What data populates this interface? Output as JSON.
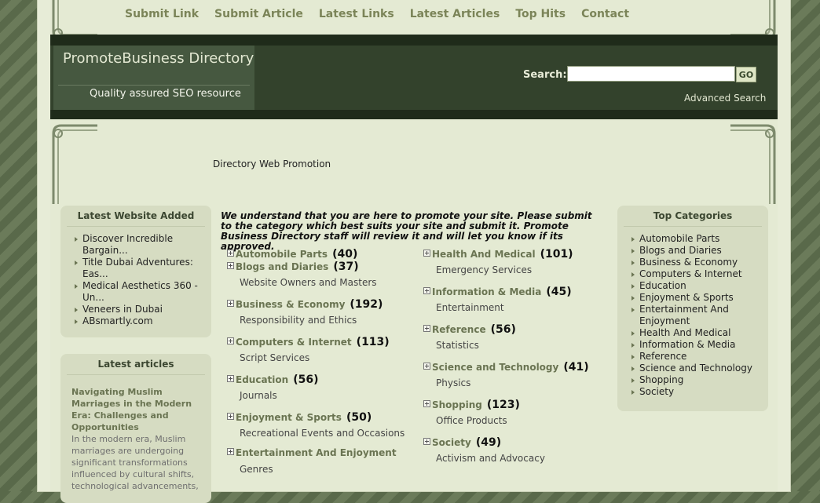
{
  "nav": [
    "Submit Link",
    "Submit Article",
    "Latest Links",
    "Latest Articles",
    "Top Hits",
    "Contact"
  ],
  "header": {
    "title": "PromoteBusiness Directory",
    "subtitle": "Quality assured SEO resource",
    "search_label": "Search:",
    "search_value": "",
    "go_label": "GO",
    "advanced": "Advanced Search"
  },
  "tagline": "Directory Web Promotion",
  "latest_websites": {
    "title": "Latest Website Added",
    "items": [
      "Discover Incredible Bargain...",
      "Title Dubai Adventures: Eas...",
      "Medical Aesthetics 360 - Un...",
      "Veneers in Dubai",
      "ABsmartly.com"
    ]
  },
  "latest_articles": {
    "title": "Latest articles",
    "article_title": "Navigating Muslim Marriages in the Modern Era: Challenges and Opportunities",
    "article_body": "In the modern era, Muslim marriages are undergoing significant transformations influenced by cultural shifts, technological advancements,"
  },
  "intro": "We understand that you are here to promote your site. Please submit to the category which best suits your site and submit it. Promote Business Directory staff will review it and will let you know if its approved.",
  "categories_col1": [
    {
      "name": "Automobile Parts",
      "count": "(40)",
      "sub": ""
    },
    {
      "name": "Blogs and Diaries",
      "count": "(37)",
      "sub": "Website Owners and Masters"
    },
    {
      "name": "Business & Economy",
      "count": "(192)",
      "sub": "Responsibility and Ethics"
    },
    {
      "name": "Computers & Internet",
      "count": "(113)",
      "sub": "Script Services"
    },
    {
      "name": "Education",
      "count": "(56)",
      "sub": "Journals"
    },
    {
      "name": "Enjoyment & Sports",
      "count": "(50)",
      "sub": "Recreational Events and Occasions"
    },
    {
      "name": "Entertainment And Enjoyment",
      "count": "",
      "sub": "Genres"
    }
  ],
  "categories_col2": [
    {
      "name": "Health And Medical",
      "count": "(101)",
      "sub": "Emergency Services"
    },
    {
      "name": "Information & Media",
      "count": "(45)",
      "sub": "Entertainment"
    },
    {
      "name": "Reference",
      "count": "(56)",
      "sub": "Statistics"
    },
    {
      "name": "Science and Technology",
      "count": "(41)",
      "sub": "Physics"
    },
    {
      "name": "Shopping",
      "count": "(123)",
      "sub": "Office Products"
    },
    {
      "name": "Society",
      "count": "(49)",
      "sub": "Activism and Advocacy"
    }
  ],
  "top_categories": {
    "title": "Top Categories",
    "items": [
      "Automobile Parts",
      "Blogs and Diaries",
      "Business & Economy",
      "Computers & Internet",
      "Education",
      "Enjoyment & Sports",
      "Entertainment And Enjoyment",
      "Health And Medical",
      "Information & Media",
      "Reference",
      "Science and Technology",
      "Shopping",
      "Society"
    ]
  }
}
